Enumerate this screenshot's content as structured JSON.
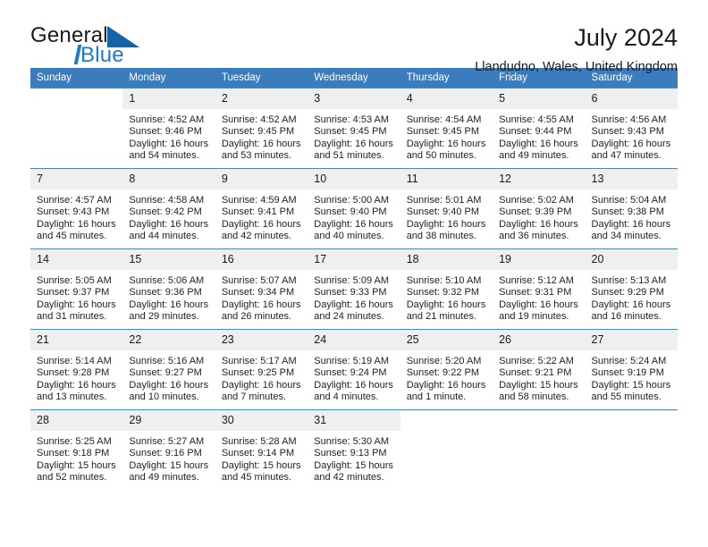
{
  "brand": {
    "name_part1": "General",
    "name_part2": "Blue",
    "accent_color": "#1e7bc4"
  },
  "header": {
    "title": "July 2024",
    "subtitle": "Llandudno, Wales, United Kingdom",
    "header_bg_color": "#3a7cbe",
    "daynum_bg_color": "#efefef"
  },
  "weekday_headers": [
    "Sunday",
    "Monday",
    "Tuesday",
    "Wednesday",
    "Thursday",
    "Friday",
    "Saturday"
  ],
  "labels": {
    "sunrise": "Sunrise:",
    "sunset": "Sunset:",
    "daylight": "Daylight:"
  },
  "weeks": [
    [
      {
        "day": "",
        "blank": true
      },
      {
        "day": "1",
        "sunrise": "Sunrise: 4:52 AM",
        "sunset": "Sunset: 9:46 PM",
        "daylight1": "Daylight: 16 hours",
        "daylight2": "and 54 minutes."
      },
      {
        "day": "2",
        "sunrise": "Sunrise: 4:52 AM",
        "sunset": "Sunset: 9:45 PM",
        "daylight1": "Daylight: 16 hours",
        "daylight2": "and 53 minutes."
      },
      {
        "day": "3",
        "sunrise": "Sunrise: 4:53 AM",
        "sunset": "Sunset: 9:45 PM",
        "daylight1": "Daylight: 16 hours",
        "daylight2": "and 51 minutes."
      },
      {
        "day": "4",
        "sunrise": "Sunrise: 4:54 AM",
        "sunset": "Sunset: 9:45 PM",
        "daylight1": "Daylight: 16 hours",
        "daylight2": "and 50 minutes."
      },
      {
        "day": "5",
        "sunrise": "Sunrise: 4:55 AM",
        "sunset": "Sunset: 9:44 PM",
        "daylight1": "Daylight: 16 hours",
        "daylight2": "and 49 minutes."
      },
      {
        "day": "6",
        "sunrise": "Sunrise: 4:56 AM",
        "sunset": "Sunset: 9:43 PM",
        "daylight1": "Daylight: 16 hours",
        "daylight2": "and 47 minutes."
      }
    ],
    [
      {
        "day": "7",
        "sunrise": "Sunrise: 4:57 AM",
        "sunset": "Sunset: 9:43 PM",
        "daylight1": "Daylight: 16 hours",
        "daylight2": "and 45 minutes."
      },
      {
        "day": "8",
        "sunrise": "Sunrise: 4:58 AM",
        "sunset": "Sunset: 9:42 PM",
        "daylight1": "Daylight: 16 hours",
        "daylight2": "and 44 minutes."
      },
      {
        "day": "9",
        "sunrise": "Sunrise: 4:59 AM",
        "sunset": "Sunset: 9:41 PM",
        "daylight1": "Daylight: 16 hours",
        "daylight2": "and 42 minutes."
      },
      {
        "day": "10",
        "sunrise": "Sunrise: 5:00 AM",
        "sunset": "Sunset: 9:40 PM",
        "daylight1": "Daylight: 16 hours",
        "daylight2": "and 40 minutes."
      },
      {
        "day": "11",
        "sunrise": "Sunrise: 5:01 AM",
        "sunset": "Sunset: 9:40 PM",
        "daylight1": "Daylight: 16 hours",
        "daylight2": "and 38 minutes."
      },
      {
        "day": "12",
        "sunrise": "Sunrise: 5:02 AM",
        "sunset": "Sunset: 9:39 PM",
        "daylight1": "Daylight: 16 hours",
        "daylight2": "and 36 minutes."
      },
      {
        "day": "13",
        "sunrise": "Sunrise: 5:04 AM",
        "sunset": "Sunset: 9:38 PM",
        "daylight1": "Daylight: 16 hours",
        "daylight2": "and 34 minutes."
      }
    ],
    [
      {
        "day": "14",
        "sunrise": "Sunrise: 5:05 AM",
        "sunset": "Sunset: 9:37 PM",
        "daylight1": "Daylight: 16 hours",
        "daylight2": "and 31 minutes."
      },
      {
        "day": "15",
        "sunrise": "Sunrise: 5:06 AM",
        "sunset": "Sunset: 9:36 PM",
        "daylight1": "Daylight: 16 hours",
        "daylight2": "and 29 minutes."
      },
      {
        "day": "16",
        "sunrise": "Sunrise: 5:07 AM",
        "sunset": "Sunset: 9:34 PM",
        "daylight1": "Daylight: 16 hours",
        "daylight2": "and 26 minutes."
      },
      {
        "day": "17",
        "sunrise": "Sunrise: 5:09 AM",
        "sunset": "Sunset: 9:33 PM",
        "daylight1": "Daylight: 16 hours",
        "daylight2": "and 24 minutes."
      },
      {
        "day": "18",
        "sunrise": "Sunrise: 5:10 AM",
        "sunset": "Sunset: 9:32 PM",
        "daylight1": "Daylight: 16 hours",
        "daylight2": "and 21 minutes."
      },
      {
        "day": "19",
        "sunrise": "Sunrise: 5:12 AM",
        "sunset": "Sunset: 9:31 PM",
        "daylight1": "Daylight: 16 hours",
        "daylight2": "and 19 minutes."
      },
      {
        "day": "20",
        "sunrise": "Sunrise: 5:13 AM",
        "sunset": "Sunset: 9:29 PM",
        "daylight1": "Daylight: 16 hours",
        "daylight2": "and 16 minutes."
      }
    ],
    [
      {
        "day": "21",
        "sunrise": "Sunrise: 5:14 AM",
        "sunset": "Sunset: 9:28 PM",
        "daylight1": "Daylight: 16 hours",
        "daylight2": "and 13 minutes."
      },
      {
        "day": "22",
        "sunrise": "Sunrise: 5:16 AM",
        "sunset": "Sunset: 9:27 PM",
        "daylight1": "Daylight: 16 hours",
        "daylight2": "and 10 minutes."
      },
      {
        "day": "23",
        "sunrise": "Sunrise: 5:17 AM",
        "sunset": "Sunset: 9:25 PM",
        "daylight1": "Daylight: 16 hours",
        "daylight2": "and 7 minutes."
      },
      {
        "day": "24",
        "sunrise": "Sunrise: 5:19 AM",
        "sunset": "Sunset: 9:24 PM",
        "daylight1": "Daylight: 16 hours",
        "daylight2": "and 4 minutes."
      },
      {
        "day": "25",
        "sunrise": "Sunrise: 5:20 AM",
        "sunset": "Sunset: 9:22 PM",
        "daylight1": "Daylight: 16 hours",
        "daylight2": "and 1 minute."
      },
      {
        "day": "26",
        "sunrise": "Sunrise: 5:22 AM",
        "sunset": "Sunset: 9:21 PM",
        "daylight1": "Daylight: 15 hours",
        "daylight2": "and 58 minutes."
      },
      {
        "day": "27",
        "sunrise": "Sunrise: 5:24 AM",
        "sunset": "Sunset: 9:19 PM",
        "daylight1": "Daylight: 15 hours",
        "daylight2": "and 55 minutes."
      }
    ],
    [
      {
        "day": "28",
        "sunrise": "Sunrise: 5:25 AM",
        "sunset": "Sunset: 9:18 PM",
        "daylight1": "Daylight: 15 hours",
        "daylight2": "and 52 minutes."
      },
      {
        "day": "29",
        "sunrise": "Sunrise: 5:27 AM",
        "sunset": "Sunset: 9:16 PM",
        "daylight1": "Daylight: 15 hours",
        "daylight2": "and 49 minutes."
      },
      {
        "day": "30",
        "sunrise": "Sunrise: 5:28 AM",
        "sunset": "Sunset: 9:14 PM",
        "daylight1": "Daylight: 15 hours",
        "daylight2": "and 45 minutes."
      },
      {
        "day": "31",
        "sunrise": "Sunrise: 5:30 AM",
        "sunset": "Sunset: 9:13 PM",
        "daylight1": "Daylight: 15 hours",
        "daylight2": "and 42 minutes."
      },
      {
        "day": "",
        "blank": true
      },
      {
        "day": "",
        "blank": true
      },
      {
        "day": "",
        "blank": true
      }
    ]
  ]
}
